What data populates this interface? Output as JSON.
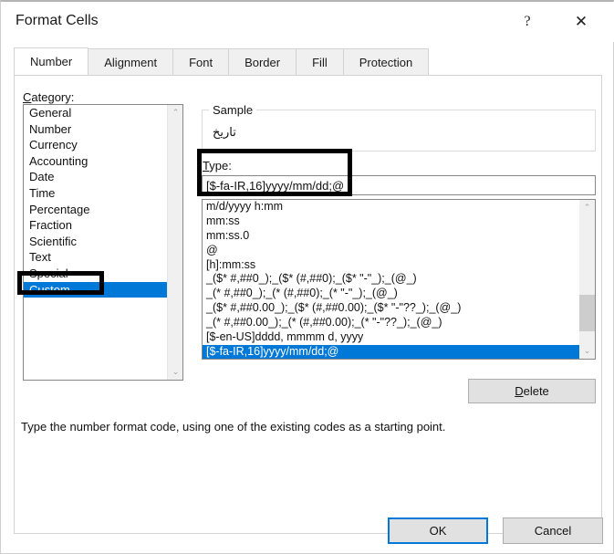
{
  "dialog": {
    "title": "Format Cells",
    "help_glyph": "?",
    "close_glyph": "✕"
  },
  "tabs": [
    {
      "label": "Number",
      "active": true
    },
    {
      "label": "Alignment",
      "active": false
    },
    {
      "label": "Font",
      "active": false
    },
    {
      "label": "Border",
      "active": false
    },
    {
      "label": "Fill",
      "active": false
    },
    {
      "label": "Protection",
      "active": false
    }
  ],
  "category": {
    "label_accel": "C",
    "label_rest": "ategory:",
    "selected": "Custom",
    "items": [
      "General",
      "Number",
      "Currency",
      "Accounting",
      "Date",
      "Time",
      "Percentage",
      "Fraction",
      "Scientific",
      "Text",
      "Special",
      "Custom"
    ]
  },
  "sample": {
    "legend": "Sample",
    "value": "تاریخ"
  },
  "type": {
    "label_accel": "T",
    "label_rest": "ype:",
    "value": "[$-fa-IR,16]yyyy/mm/dd;@"
  },
  "format_list": {
    "selected": "[$-fa-IR,16]yyyy/mm/dd;@",
    "items": [
      "m/d/yyyy h:mm",
      "mm:ss",
      "mm:ss.0",
      "@",
      "[h]:mm:ss",
      "_($* #,##0_);_($* (#,##0);_($* \"-\"_);_(@_)",
      "_(* #,##0_);_(* (#,##0);_(* \"-\"_);_(@_)",
      "_($* #,##0.00_);_($* (#,##0.00);_($* \"-\"??_);_(@_)",
      "_(* #,##0.00_);_(* (#,##0.00);_(* \"-\"??_);_(@_)",
      "[$-en-US]dddd, mmmm d, yyyy",
      "[$-fa-IR,16]yyyy/mm/dd;@"
    ]
  },
  "delete_button": {
    "label_accel": "D",
    "label_rest": "elete"
  },
  "hint": "Type the number format code, using one of the existing codes as a starting point.",
  "footer": {
    "ok_label": "OK",
    "cancel_label": "Cancel"
  },
  "scrollbars": {
    "up_glyph": "⌃",
    "down_glyph": "⌄"
  },
  "colors": {
    "selection_blue": "#0078d7",
    "annotation_black": "#000000",
    "button_face": "#e1e1e1",
    "panel_white": "#ffffff"
  }
}
